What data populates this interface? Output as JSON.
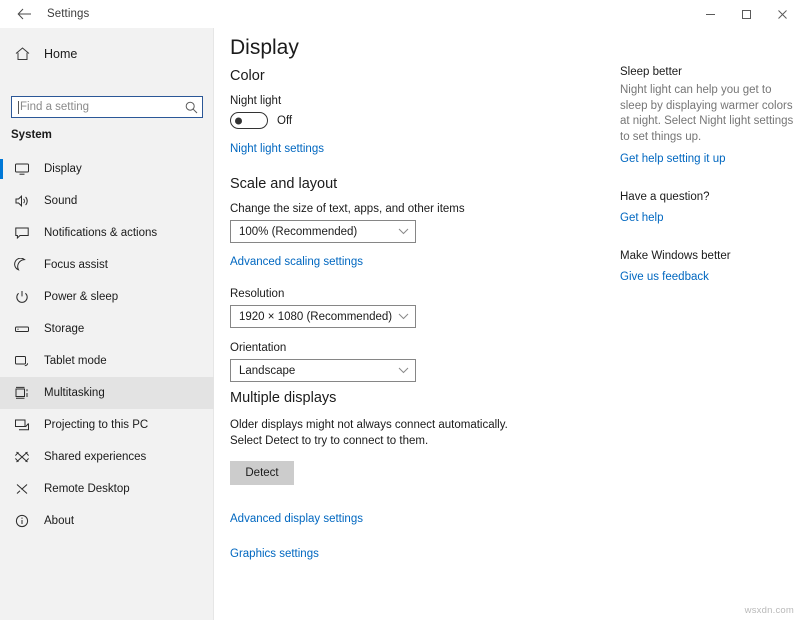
{
  "window": {
    "title": "Settings",
    "back_icon": "back-arrow-icon",
    "minimize_label": "Minimize",
    "maximize_label": "Maximize",
    "close_label": "Close"
  },
  "sidebar": {
    "home_label": "Home",
    "home_icon": "home-icon",
    "search": {
      "placeholder": "Find a setting",
      "value": "",
      "icon": "search-icon"
    },
    "group_header": "System",
    "selected_index": 0,
    "hover_index": 7,
    "items": [
      {
        "label": "Display",
        "icon": "monitor-icon"
      },
      {
        "label": "Sound",
        "icon": "speaker-icon"
      },
      {
        "label": "Notifications & actions",
        "icon": "notification-icon"
      },
      {
        "label": "Focus assist",
        "icon": "moon-icon"
      },
      {
        "label": "Power & sleep",
        "icon": "power-icon"
      },
      {
        "label": "Storage",
        "icon": "storage-icon"
      },
      {
        "label": "Tablet mode",
        "icon": "tablet-icon"
      },
      {
        "label": "Multitasking",
        "icon": "multitasking-icon"
      },
      {
        "label": "Projecting to this PC",
        "icon": "projector-icon"
      },
      {
        "label": "Shared experiences",
        "icon": "share-icon"
      },
      {
        "label": "Remote Desktop",
        "icon": "remote-desktop-icon"
      },
      {
        "label": "About",
        "icon": "info-icon"
      }
    ]
  },
  "main": {
    "page_title": "Display",
    "color": {
      "section_title": "Color",
      "night_light_label": "Night light",
      "night_light_state": "Off",
      "night_light_on": false,
      "settings_link": "Night light settings"
    },
    "scale": {
      "section_title": "Scale and layout",
      "size_label": "Change the size of text, apps, and other items",
      "size_value": "100% (Recommended)",
      "advanced_link": "Advanced scaling settings",
      "resolution_label": "Resolution",
      "resolution_value": "1920 × 1080 (Recommended)",
      "orientation_label": "Orientation",
      "orientation_value": "Landscape"
    },
    "multiple_displays": {
      "section_title": "Multiple displays",
      "description": "Older displays might not always connect automatically. Select Detect to try to connect to them.",
      "detect_button": "Detect",
      "advanced_display_link": "Advanced display settings",
      "graphics_link": "Graphics settings"
    }
  },
  "help_panel": {
    "blocks": [
      {
        "title": "Sleep better",
        "description": "Night light can help you get to sleep by displaying warmer colors at night. Select Night light settings to set things up.",
        "link": "Get help setting it up"
      },
      {
        "title": "Have a question?",
        "description": "",
        "link": "Get help"
      },
      {
        "title": "Make Windows better",
        "description": "",
        "link": "Give us feedback"
      }
    ]
  },
  "watermark": "wsxdn.com",
  "colors": {
    "accent": "#0078d7",
    "link": "#0067c0",
    "sidebar_bg": "#f2f2f2",
    "hover_bg": "#e3e3e3"
  }
}
